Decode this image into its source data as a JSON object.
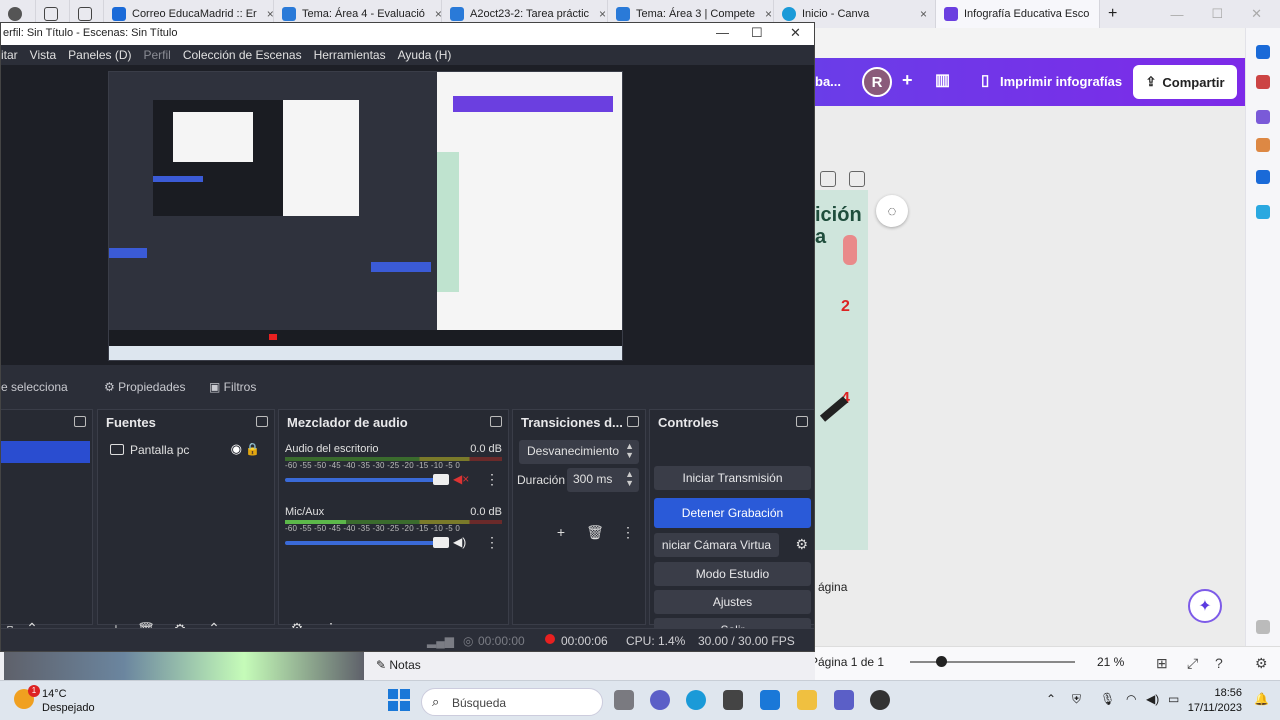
{
  "browser": {
    "tabs": [
      {
        "title": "Correo EducaMadrid :: Er",
        "color": "#1a6ad8"
      },
      {
        "title": "Tema: Área 4 - Evaluació",
        "color": "#2a7ad8"
      },
      {
        "title": "A2oct23-2: Tarea práctic",
        "color": "#2a7ad8"
      },
      {
        "title": "Tema: Área 3 | Compete",
        "color": "#2a7ad8"
      },
      {
        "title": "Inicio - Canva",
        "color": "#1a9ad8"
      },
      {
        "title": "Infografía Educativa Esco",
        "color": "#6b3fe0"
      }
    ],
    "new_tab": "+",
    "close_glyph": "×"
  },
  "canva": {
    "toolbar_text": "ba...",
    "avatar_letter": "R",
    "print_label": "Imprimir infografías",
    "share_label": "Compartir",
    "design_heading": "ición",
    "design_heading2": "a",
    "pagina_label": "ágina",
    "status": {
      "page": "Página 1 de 1",
      "zoom": "21 %",
      "zoom_fraction": 0.19
    }
  },
  "obs": {
    "title": "erfil: Sin Título - Escenas: Sin Título",
    "menu": [
      "itar",
      "Vista",
      "Paneles (D)",
      "Perfil",
      "Colección de Escenas",
      "Herramientas",
      "Ayuda (H)"
    ],
    "tabs": {
      "selection": "e selecciona",
      "properties": "Propiedades",
      "filters": "Filtros"
    },
    "docks": {
      "sources_title": "Fuentes",
      "source_item": "Pantalla pc",
      "mixer_title": "Mezclador de audio",
      "transitions_title": "Transiciones d...",
      "controls_title": "Controles"
    },
    "mixer": [
      {
        "name": "Audio del escritorio",
        "db": "0.0 dB",
        "scale": "-60 -55 -50 -45 -40 -35 -30 -25 -20 -15 -10 -5 0",
        "volume": 1.0
      },
      {
        "name": "Mic/Aux",
        "db": "0.0 dB",
        "scale": "-60 -55 -50 -45 -40 -35 -30 -25 -20 -15 -10 -5 0",
        "volume": 1.0
      }
    ],
    "transitions": {
      "selected": "Desvanecimiento",
      "duration_label": "Duración",
      "duration_value": "300 ms"
    },
    "controls": {
      "start_stream": "Iniciar Transmisión",
      "stop_recording": "Detener Grabación",
      "virtual_cam": "niciar Cámara Virtua",
      "studio_mode": "Modo Estudio",
      "settings": "Ajustes",
      "exit": "Salir"
    },
    "status": {
      "stream_time": "00:00:00",
      "rec_time": "00:00:06",
      "cpu": "CPU: 1.4%",
      "fps": "30.00 / 30.00 FPS"
    }
  },
  "notes_label": "Notas",
  "taskbar": {
    "temp": "14°C",
    "condition": "Despejado",
    "notif_count": "1",
    "search_placeholder": "Búsqueda",
    "time": "18:56",
    "date": "17/11/2023"
  }
}
